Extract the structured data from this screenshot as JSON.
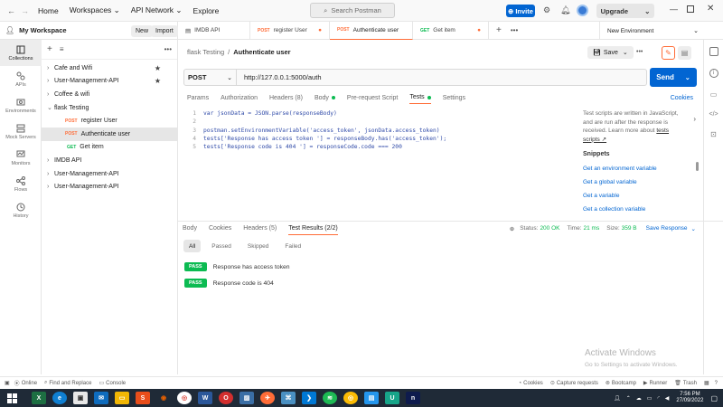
{
  "titlebar": {
    "menu": [
      "Home",
      "Workspaces",
      "API Network",
      "Explore"
    ],
    "search_placeholder": "Search Postman",
    "invite": "Invite",
    "upgrade": "Upgrade"
  },
  "workspace": {
    "name": "My Workspace",
    "new_btn": "New",
    "import_btn": "Import"
  },
  "rail": [
    {
      "label": "Collections",
      "icon": "collections-icon"
    },
    {
      "label": "APIs",
      "icon": "apis-icon"
    },
    {
      "label": "Environments",
      "icon": "environments-icon"
    },
    {
      "label": "Mock Servers",
      "icon": "mock-servers-icon"
    },
    {
      "label": "Monitors",
      "icon": "monitors-icon"
    },
    {
      "label": "Flows",
      "icon": "flows-icon"
    },
    {
      "label": "History",
      "icon": "history-icon"
    }
  ],
  "collections": [
    {
      "label": "Cafe and Wifi",
      "star": true
    },
    {
      "label": "User-Management-API",
      "star": true
    },
    {
      "label": "Coffee & wifi",
      "star": false
    },
    {
      "label": "flask Testing",
      "star": false,
      "open": true
    },
    {
      "label": "register User",
      "method": "POST",
      "child": true
    },
    {
      "label": "Authenticate user",
      "method": "POST",
      "child": true,
      "active": true
    },
    {
      "label": "Get item",
      "method": "GET",
      "child": true
    },
    {
      "label": "IMDB API",
      "star": false
    },
    {
      "label": "User-Management-API",
      "star": false
    },
    {
      "label": "User-Management-API",
      "star": false
    }
  ],
  "tabs": [
    {
      "label": "IMDB API",
      "method": ""
    },
    {
      "label": "register User",
      "method": "POST"
    },
    {
      "label": "Authenticate user",
      "method": "POST",
      "active": true
    },
    {
      "label": "Get item",
      "method": "GET"
    }
  ],
  "environment": "New Environment",
  "breadcrumb": {
    "parent": "flask Testing",
    "separator": "/",
    "current": "Authenticate user"
  },
  "save_label": "Save",
  "request": {
    "method": "POST",
    "url": "http://127.0.0.1:5000/auth",
    "send": "Send",
    "cookies": "Cookies",
    "subtabs": [
      "Params",
      "Authorization",
      "Headers (8)",
      "Body",
      "Pre-request Script",
      "Tests",
      "Settings"
    ]
  },
  "code_lines": [
    "var jsonData = JSON.parse(responseBody)",
    "",
    "postman.setEnvironmentVariable('access_token', jsonData.access_token)",
    "tests['Response has access token '] = responseBody.has('access_token');",
    "tests['Response code is 404 '] = responseCode.code === 200"
  ],
  "snippets_panel": {
    "intro": "Test scripts are written in JavaScript, and are run after the response is received. Learn more about",
    "intro_link": "tests scripts ↗",
    "title": "Snippets",
    "items": [
      "Get an environment variable",
      "Get a global variable",
      "Get a variable",
      "Get a collection variable"
    ]
  },
  "response": {
    "tabs": [
      "Body",
      "Cookies",
      "Headers (5)",
      "Test Results (2/2)"
    ],
    "status_label": "Status:",
    "status": "200 OK",
    "time_label": "Time:",
    "time": "21 ms",
    "size_label": "Size:",
    "size": "359 B",
    "save_response": "Save Response",
    "filters": [
      "All",
      "Passed",
      "Skipped",
      "Failed"
    ],
    "results": [
      {
        "badge": "PASS",
        "text": "Response has access token"
      },
      {
        "badge": "PASS",
        "text": "Response code is 404"
      }
    ]
  },
  "statusbar": {
    "left": [
      "Online",
      "Find and Replace",
      "Console"
    ],
    "right": [
      "Cookies",
      "Capture requests",
      "Bootcamp",
      "Runner",
      "Trash"
    ]
  },
  "watermark": {
    "title": "Activate Windows",
    "sub": "Go to Settings to activate Windows."
  },
  "taskbar": {
    "time": "7:56 PM",
    "date": "27/09/2022"
  },
  "colors": {
    "accent": "#ff6c37",
    "primary": "#0265d2",
    "pass": "#0cbb52"
  }
}
